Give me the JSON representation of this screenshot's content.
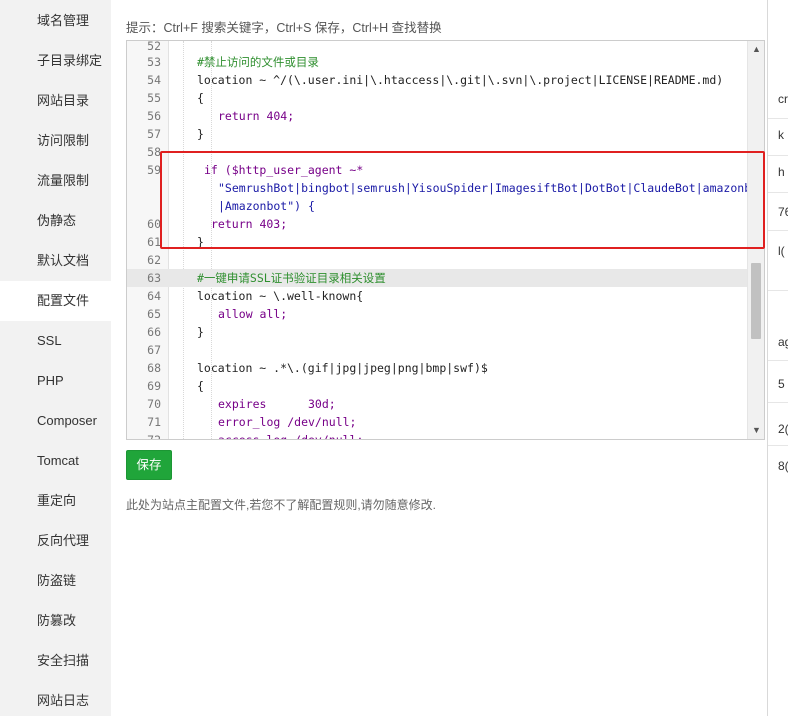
{
  "sidebar": {
    "items": [
      {
        "label": "域名管理",
        "active": false
      },
      {
        "label": "子目录绑定",
        "active": false
      },
      {
        "label": "网站目录",
        "active": false
      },
      {
        "label": "访问限制",
        "active": false
      },
      {
        "label": "流量限制",
        "active": false
      },
      {
        "label": "伪静态",
        "active": false
      },
      {
        "label": "默认文档",
        "active": false
      },
      {
        "label": "配置文件",
        "active": true
      },
      {
        "label": "SSL",
        "active": false
      },
      {
        "label": "PHP",
        "active": false
      },
      {
        "label": "Composer",
        "active": false
      },
      {
        "label": "Tomcat",
        "active": false
      },
      {
        "label": "重定向",
        "active": false
      },
      {
        "label": "反向代理",
        "active": false
      },
      {
        "label": "防盗链",
        "active": false
      },
      {
        "label": "防篡改",
        "active": false
      },
      {
        "label": "安全扫描",
        "active": false
      },
      {
        "label": "网站日志",
        "active": false
      }
    ]
  },
  "hint": "提示：Ctrl+F 搜索关键字，Ctrl+S 保存，Ctrl+H 查找替换",
  "editor": {
    "lines": [
      {
        "n": "52",
        "text": ""
      },
      {
        "n": "53",
        "text": "#禁止访问的文件或目录"
      },
      {
        "n": "54",
        "text": "location ~ ^/(\\.user.ini|\\.htaccess|\\.git|\\.svn|\\.project|LICENSE|README.md)"
      },
      {
        "n": "55",
        "text": "{"
      },
      {
        "n": "56",
        "text": "return 404;"
      },
      {
        "n": "57",
        "text": "}"
      },
      {
        "n": "58",
        "text": ""
      },
      {
        "n": "59",
        "text": "if ($http_user_agent ~*"
      },
      {
        "n": "",
        "text": "\"SemrushBot|bingbot|semrush|YisouSpider|ImagesiftBot|DotBot|ClaudeBot|amazonbot"
      },
      {
        "n": "",
        "text": "|Amazonbot\") {"
      },
      {
        "n": "60",
        "text": "return 403;"
      },
      {
        "n": "61",
        "text": "}"
      },
      {
        "n": "62",
        "text": ""
      },
      {
        "n": "63",
        "text": "#一键申请SSL证书验证目录相关设置"
      },
      {
        "n": "64",
        "text": "location ~ \\.well-known{"
      },
      {
        "n": "65",
        "text": "allow all;"
      },
      {
        "n": "66",
        "text": "}"
      },
      {
        "n": "67",
        "text": ""
      },
      {
        "n": "68",
        "text": "location ~ .*\\.(gif|jpg|jpeg|png|bmp|swf)$"
      },
      {
        "n": "69",
        "text": "{"
      },
      {
        "n": "70",
        "text": "expires      30d;"
      },
      {
        "n": "71",
        "text": "error_log /dev/null;"
      },
      {
        "n": "72",
        "text": "access_log /dev/null;"
      }
    ]
  },
  "save_label": "保存",
  "note": "此处为站点主配置文件,若您不了解配置规则,请勿随意修改.",
  "right_strip": [
    "cr",
    "k",
    "h",
    "76",
    "l(",
    "ag",
    "5",
    "2(",
    "8("
  ]
}
